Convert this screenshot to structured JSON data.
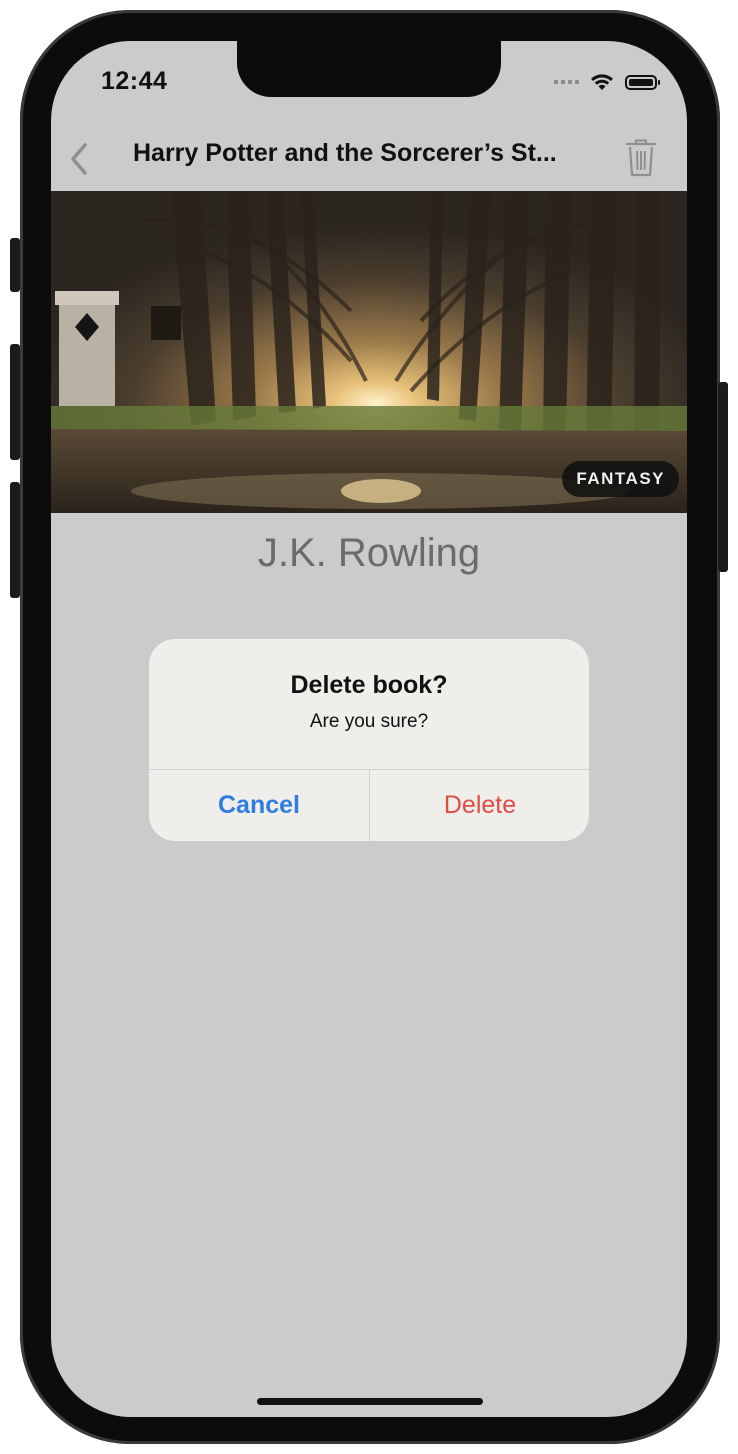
{
  "status_bar": {
    "time": "12:44",
    "wifi_icon": "wifi-icon",
    "battery_icon": "battery-icon"
  },
  "nav": {
    "title": "Harry Potter and the Sorcerer’s St...",
    "back_icon": "chevron-left-icon",
    "trash_icon": "trash-icon"
  },
  "book": {
    "genre": "FANTASY",
    "author": "J.K. Rowling"
  },
  "alert": {
    "title": "Delete book?",
    "message": "Are you sure?",
    "cancel_label": "Cancel",
    "delete_label": "Delete"
  },
  "colors": {
    "screen_dim": "#cbcbcb",
    "cancel": "#2f7de0",
    "delete": "#e04b44"
  }
}
